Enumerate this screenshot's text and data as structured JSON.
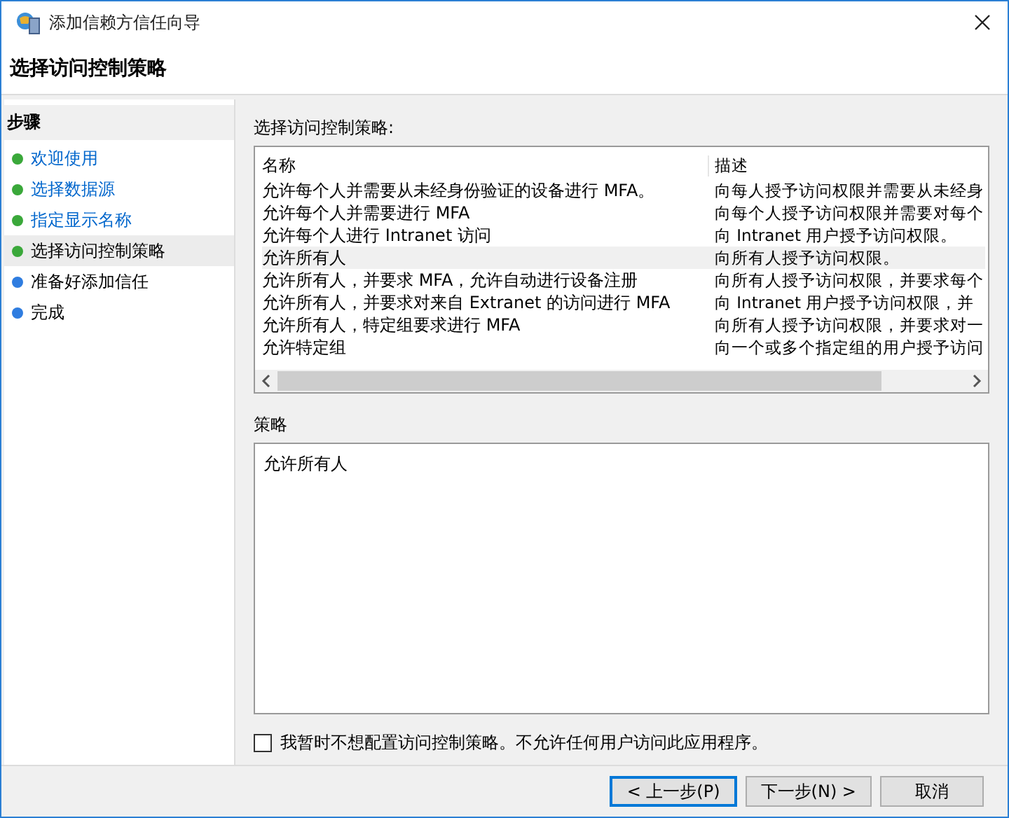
{
  "window": {
    "title": "添加信赖方信任向导"
  },
  "page_title": "选择访问控制策略",
  "sidebar": {
    "heading": "步骤",
    "items": [
      {
        "label": "欢迎使用",
        "kind": "link",
        "color": "#3aa83a",
        "selected": false
      },
      {
        "label": "选择数据源",
        "kind": "link",
        "color": "#3aa83a",
        "selected": false
      },
      {
        "label": "指定显示名称",
        "kind": "link",
        "color": "#3aa83a",
        "selected": false
      },
      {
        "label": "选择访问控制策略",
        "kind": "plain",
        "color": "#3aa83a",
        "selected": true
      },
      {
        "label": "准备好添加信任",
        "kind": "plain",
        "color": "#2f7de0",
        "selected": false
      },
      {
        "label": "完成",
        "kind": "plain",
        "color": "#2f7de0",
        "selected": false
      }
    ]
  },
  "policy_list": {
    "label": "选择访问控制策略:",
    "columns": [
      "名称",
      "描述"
    ],
    "rows": [
      {
        "name": "允许每个人并需要从未经身份验证的设备进行 MFA。",
        "description": "向每人授予访问权限并需要从未经身",
        "selected": false
      },
      {
        "name": "允许每个人并需要进行 MFA",
        "description": "向每个人授予访问权限并需要对每个",
        "selected": false
      },
      {
        "name": "允许每个人进行 Intranet 访问",
        "description": "向 Intranet 用户授予访问权限。",
        "selected": false
      },
      {
        "name": "允许所有人",
        "description": "向所有人授予访问权限。",
        "selected": true
      },
      {
        "name": "允许所有人，并要求 MFA，允许自动进行设备注册",
        "description": "向所有人授予访问权限，并要求每个",
        "selected": false
      },
      {
        "name": "允许所有人，并要求对来自 Extranet 的访问进行 MFA",
        "description": "向 Intranet 用户授予访问权限，并",
        "selected": false
      },
      {
        "name": "允许所有人，特定组要求进行 MFA",
        "description": "向所有人授予访问权限，并要求对一",
        "selected": false
      },
      {
        "name": "允许特定组",
        "description": "向一个或多个指定组的用户授予访问",
        "selected": false
      }
    ]
  },
  "policy": {
    "label": "策略",
    "value": "允许所有人"
  },
  "skip_checkbox": {
    "label": "我暂时不想配置访问控制策略。不允许任何用户访问此应用程序。",
    "checked": false
  },
  "buttons": [
    {
      "label": "< 上一步(P)",
      "focused": true
    },
    {
      "label": "下一步(N) >",
      "focused": false
    },
    {
      "label": "取消",
      "focused": false
    }
  ]
}
